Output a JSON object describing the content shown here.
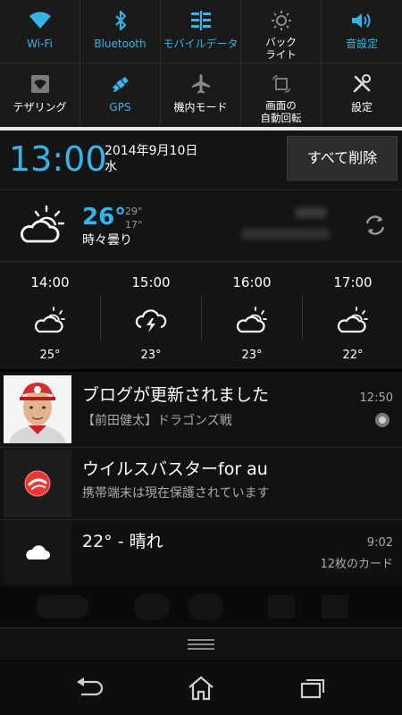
{
  "quick_settings": {
    "row1": [
      {
        "label": "Wi-Fi",
        "icon": "wifi-icon",
        "active": true
      },
      {
        "label": "Bluetooth",
        "icon": "bluetooth-icon",
        "active": true
      },
      {
        "label": "モバイルデータ",
        "icon": "mobile-data-icon",
        "active": true
      },
      {
        "label_lines": [
          "バック",
          "ライト"
        ],
        "icon": "brightness-icon",
        "active": false
      },
      {
        "label": "音設定",
        "icon": "sound-icon",
        "active": true
      }
    ],
    "row2": [
      {
        "label": "テザリング",
        "icon": "tethering-icon",
        "active": false
      },
      {
        "label": "GPS",
        "icon": "gps-icon",
        "active": true
      },
      {
        "label": "機内モード",
        "icon": "airplane-icon",
        "active": false
      },
      {
        "label_lines": [
          "画面の",
          "自動回転"
        ],
        "icon": "auto-rotate-icon",
        "active": false
      },
      {
        "label": "設定",
        "icon": "settings-tools-icon",
        "active": false
      }
    ]
  },
  "header": {
    "time": "13:00",
    "date": "2014年9月10日",
    "weekday": "水",
    "clear_all": "すべて削除"
  },
  "weather": {
    "current_temp": "26°",
    "high": "29°",
    "low": "17°",
    "condition": "時々曇り",
    "hourly": [
      {
        "time": "14:00",
        "temp": "25°",
        "icon": "partly-cloudy-icon"
      },
      {
        "time": "15:00",
        "temp": "23°",
        "icon": "thunderstorm-icon"
      },
      {
        "time": "16:00",
        "temp": "23°",
        "icon": "partly-cloudy-icon"
      },
      {
        "time": "17:00",
        "temp": "22°",
        "icon": "partly-cloudy-icon"
      }
    ]
  },
  "notifications": [
    {
      "title": "ブログが更新されました",
      "subtitle": "【前田健太】ドラゴンズ戦",
      "time": "12:50",
      "icon": "player-avatar"
    },
    {
      "title": "ウイルスバスターfor au",
      "subtitle": "携帯端末は現在保護されています",
      "time": "",
      "icon": "virusbuster-icon"
    },
    {
      "title": "22° - 晴れ",
      "subtitle": "",
      "time": "9:02",
      "extra": "12枚のカード",
      "icon": "cloud-icon"
    }
  ],
  "colors": {
    "accent": "#35b4e8",
    "background": "#000000",
    "panel": "#141414"
  }
}
